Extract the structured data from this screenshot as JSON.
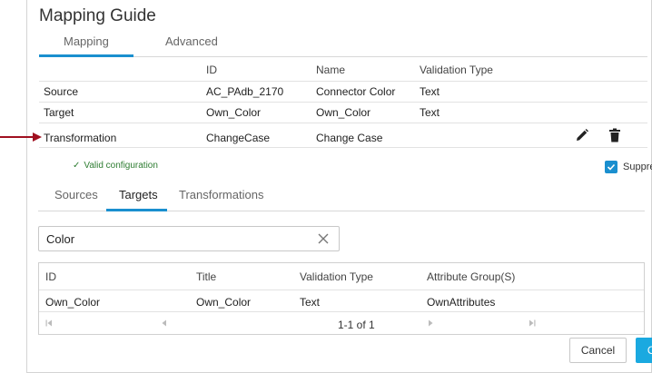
{
  "dialog": {
    "title": "Mapping Guide"
  },
  "main_tabs": [
    {
      "label": "Mapping",
      "active": true
    },
    {
      "label": "Advanced",
      "active": false
    }
  ],
  "mapping_table": {
    "headers": [
      "",
      "ID",
      "Name",
      "Validation Type"
    ],
    "rows": [
      [
        "Source",
        "AC_PAdb_2170",
        "Connector Color",
        "Text"
      ],
      [
        "Target",
        "Own_Color",
        "Own_Color",
        "Text"
      ],
      [
        "Transformation",
        "ChangeCase",
        "Change Case",
        ""
      ]
    ],
    "row_actions": [
      "pencil-icon",
      "trash-icon"
    ]
  },
  "annotation": {
    "icon": "arrow-right-icon",
    "color": "#a01020"
  },
  "status": {
    "icon": "check-icon",
    "text": "Valid configuration",
    "color": "#2e7d32"
  },
  "suppress": {
    "label": "Suppress",
    "checked": true
  },
  "sub_tabs": [
    {
      "label": "Sources",
      "active": false
    },
    {
      "label": "Targets",
      "active": true
    },
    {
      "label": "Transformations",
      "active": false
    }
  ],
  "search": {
    "value": "Color",
    "clear_icon": "close-icon"
  },
  "results": {
    "headers": [
      "ID",
      "Title",
      "Validation Type",
      "Attribute Group(S)"
    ],
    "rows": [
      [
        "Own_Color",
        "Own_Color",
        "Text",
        "OwnAttributes"
      ]
    ],
    "pager": {
      "text": "1-1 of 1",
      "icons": [
        "first-page-icon",
        "prev-page-icon",
        "next-page-icon",
        "last-page-icon"
      ]
    }
  },
  "buttons": {
    "cancel": "Cancel",
    "ok": "OK"
  },
  "colors": {
    "accent": "#1a8fcf",
    "ok_button": "#1aa9e0"
  }
}
